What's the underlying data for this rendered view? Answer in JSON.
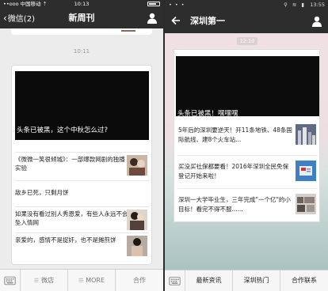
{
  "left": {
    "status": {
      "carrier": "••ooo 中国移动 ⇡",
      "time": "10:13"
    },
    "nav": {
      "back": "微信(2)",
      "title": "新周刊"
    },
    "timestamp": "10:11",
    "hero_caption": "头条已被黑，这个中秋怎么过?",
    "articles": [
      {
        "text": "《微微一笑很倾城》：一部爆款网剧的独播实验"
      },
      {
        "text": "敌乡已死，只剩月饼"
      },
      {
        "text": "如果没有看过别人秀恩爱，有些人永远不会坠入情网"
      },
      {
        "text": "亲爱的，感情不是捉奸，也不是摊煎饼"
      }
    ],
    "menu": [
      {
        "label": "微店"
      },
      {
        "label": "MORE"
      },
      {
        "label": "合作"
      }
    ]
  },
  "right": {
    "status": {
      "dots": "• • •",
      "icons": "⚲ ≋ ▮",
      "time": "13:55"
    },
    "nav": {
      "title": "深圳第一"
    },
    "timestamp": "12:10",
    "hero_caption": "头条已被黑！嘿嘿嘿",
    "articles": [
      {
        "text": "5年后的深圳要逆天！开11条地铁、48条国际航线、建8个火车站..."
      },
      {
        "text": "买没买社保都要看！2016年深圳全民免保登记开始来啦！"
      },
      {
        "text": "深圳一大学毕业生，三年完成\"一个亿\"的小目标！看完不得不服......"
      }
    ],
    "menu": [
      {
        "label": "最新资讯"
      },
      {
        "label": "深圳热门"
      },
      {
        "label": "合作联系"
      }
    ]
  },
  "colors": {
    "nav_bg": "#2d2d2d",
    "card_bg": "#ffffff",
    "hero_bg": "#0b0b0b"
  },
  "icons": [
    "back-chevron-icon",
    "user-icon",
    "keyboard-icon",
    "menu-lines-icon",
    "back-arrow-icon"
  ]
}
